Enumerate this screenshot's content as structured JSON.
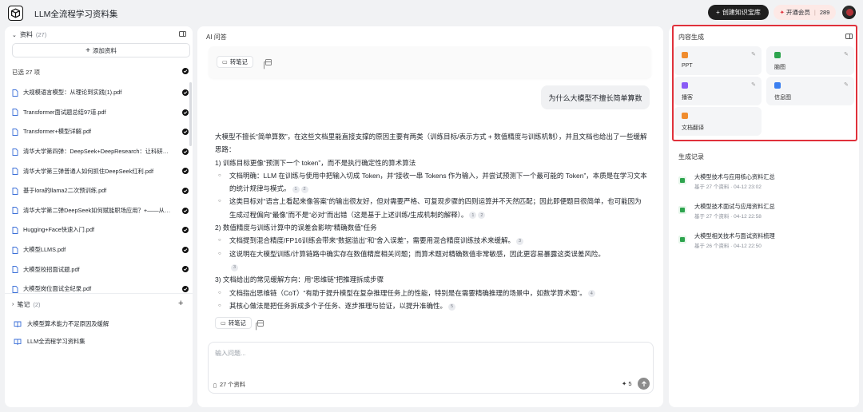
{
  "header": {
    "app_title": "LLM全流程学习资料集",
    "create_button": "创建知识宝库",
    "member_button": "开通会员",
    "member_points": "289"
  },
  "sources": {
    "title": "资料",
    "count": "(27)",
    "add_button": "添加资料",
    "selected_label": "已选 27 项",
    "items": [
      {
        "label": "大规模语言模型：从理论到实践(1).pdf"
      },
      {
        "label": "Transformer面试题总结97道.pdf"
      },
      {
        "label": "Transformer+模型详解.pdf"
      },
      {
        "label": "清华大学第四弹：DeepSeek+DeepResearch：让科研像聊天一样简单.pdf"
      },
      {
        "label": "清华大学第三弹普通人如何抓住DeepSeek红利.pdf"
      },
      {
        "label": "基于lora的llama2二次预训练.pdf"
      },
      {
        "label": "清华大学第二弹DeepSeek如何赋能职场应用？+——从提示语技巧到多场景应用.pdf"
      },
      {
        "label": "Hugging+Face快速入门.pdf"
      },
      {
        "label": "大模型LLMS.pdf"
      },
      {
        "label": "大模型校招面试题.pdf"
      },
      {
        "label": "大模型岗位面试全纪录.pdf"
      }
    ]
  },
  "notes": {
    "title": "笔记",
    "count": "(2)",
    "items": [
      {
        "label": "大模型算术能力不足原因及缓解"
      },
      {
        "label": "LLM全流程学习资料集"
      }
    ]
  },
  "chat": {
    "title": "AI 问答",
    "to_note_label": "转笔记",
    "user_question": "为什么大模型不擅长简单算数",
    "answer": {
      "intro": "大模型不擅长“简单算数”，在这些文档里能直接支撑的原因主要有两类（训练目标/表示方式 + 数值精度与训练机制），并且文档也给出了一些缓解思路：",
      "s1": "1) 训练目标更像“预测下一个 token”，而不是执行确定性的算术算法",
      "s1a": "文档明确：LLM 在训练与使用中把输入切成 Token，并“接收一串 Tokens 作为输入，并尝试预测下一个最可能的 Token”，本质是在学习文本的统计规律与模式。",
      "s1b": "这类目标对“语言上看起来像答案”的输出很友好，但对需要严格、可复现步骤的四则运算并不天然匹配；因此即便题目很简单，也可能因为生成过程偏向“最像”而不是“必对”而出错（这是基于上述训练/生成机制的解释）。",
      "s2": "2) 数值精度与训练计算中的误差会影响“精确数值”任务",
      "s2a": "文档提到混合精度/FP16训练会带来“数据溢出”和“舍入误差”，需要用混合精度训练技术来缓解。",
      "s2b": "这说明在大模型训练/计算链路中确实存在数值精度相关问题；而算术题对精确数值非常敏感，因此更容易暴露这类误差风险。",
      "s3": "3) 文档给出的常见缓解方向：用“思维链”把推理拆成步骤",
      "s3a": "文档指出思维链（CoT）“有助于提升模型在复杂推理任务上的性能，特别是在需要精确推理的场景中，如数学算术题”。",
      "s3b": "其核心做法是把任务拆成多个子任务、逐步推理与验证，以提升准确性。",
      "cites": [
        "1",
        "2",
        "1",
        "2",
        "3",
        "3",
        "4",
        "5"
      ]
    },
    "input_placeholder": "输入问题...",
    "source_count": "27 个资料",
    "credit": "5"
  },
  "generate": {
    "title": "内容生成",
    "tools": [
      {
        "label": "PPT",
        "color": "#f08c2e"
      },
      {
        "label": "脑图",
        "color": "#2da44e"
      },
      {
        "label": "播客",
        "color": "#8a5cf6"
      },
      {
        "label": "信息图",
        "color": "#3b7ff0"
      },
      {
        "label": "文档翻译",
        "color": "#f08c2e"
      }
    ],
    "records_title": "生成记录",
    "records": [
      {
        "title": "大模型技术与应用核心资料汇总",
        "meta": "基于 27 个资料 · 04-12 23:02"
      },
      {
        "title": "大模型技术面试与应用资料汇总",
        "meta": "基于 27 个资料 · 04-12 22:58"
      },
      {
        "title": "大模型相关技术与面试资料梳理",
        "meta": "基于 26 个资料 · 04-12 22:50"
      }
    ]
  }
}
